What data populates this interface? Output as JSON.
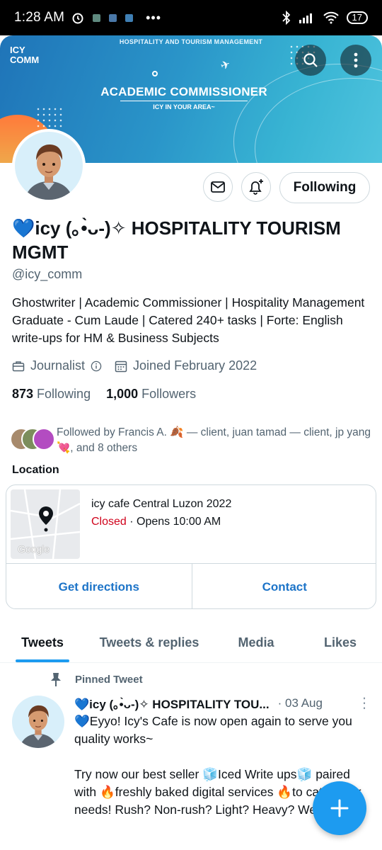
{
  "status_bar": {
    "time": "1:28 AM",
    "more_indicator": "•••",
    "battery": "17"
  },
  "banner": {
    "top_text": "HOSPITALITY AND TOURISM MANAGEMENT",
    "title": "ACADEMIC COMMISSIONER",
    "subtitle": "ICY IN YOUR AREA~",
    "logo_text": "ICY COMM",
    "colors": {
      "start": "#1f74b8",
      "end": "#4fc4de",
      "sun": "#ff7a3a"
    }
  },
  "header": {
    "back_icon": "back-arrow-icon",
    "search_icon": "search-icon",
    "more_icon": "more-vertical-icon"
  },
  "profile": {
    "name": "💙icy (｡•̀ᴗ-)✧ HOSPITALITY TOURISM MGMT",
    "handle": "@icy_comm",
    "bio": "Ghostwriter | Academic Commissioner | Hospitality Management Graduate - Cum Laude | Catered 240+ tasks | Forte: English write-ups for HM & Business Subjects",
    "category": "Journalist",
    "joined": "Joined February 2022",
    "following_count": "873",
    "following_label": "Following",
    "followers_count": "1,000",
    "followers_label": "Followers",
    "followed_by": "Followed by Francis A. 🍂 — client, juan tamad — client, jp yang 💘, and 8 others"
  },
  "actions": {
    "message_icon": "envelope-icon",
    "notify_icon": "bell-plus-icon",
    "follow_label": "Following"
  },
  "location": {
    "section_title": "Location",
    "place_name": "icy cafe Central Luzon 2022",
    "status": "Closed",
    "hours": " · Opens 10:00 AM",
    "map_label": "Google",
    "directions_label": "Get directions",
    "contact_label": "Contact"
  },
  "tabs": [
    {
      "label": "Tweets",
      "active": true
    },
    {
      "label": "Tweets & replies",
      "active": false
    },
    {
      "label": "Media",
      "active": false
    },
    {
      "label": "Likes",
      "active": false
    }
  ],
  "pinned_tweet": {
    "pinned_label": "Pinned Tweet",
    "author_name": "💙icy (｡•̀ᴗ-)✧ HOSPITALITY TOU...",
    "date": "· 03 Aug",
    "more": "⋮",
    "body": "💙Eyyo! Icy's Cafe is now open again to serve you quality works~\n\nTry now our best seller 🧊Iced Write ups🧊 paired with 🔥freshly baked digital services 🔥to cater your needs! Rush? Non-rush? Light? Heavy? We gotchu!"
  },
  "fab": {
    "icon": "plus-icon"
  },
  "accent_color": "#1d9bf0"
}
